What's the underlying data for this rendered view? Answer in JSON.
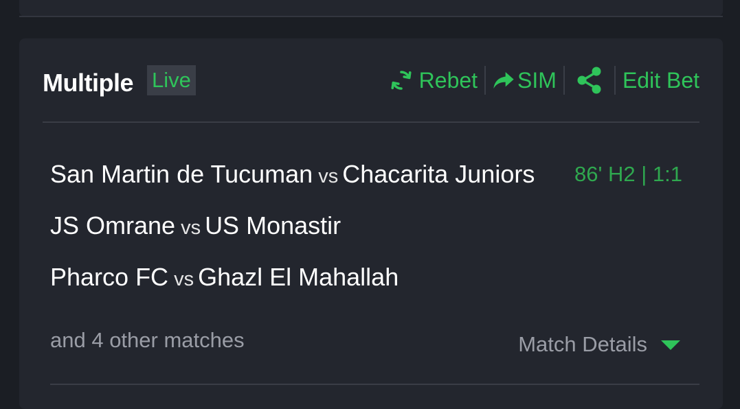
{
  "bet": {
    "title": "Multiple",
    "badge": "Live",
    "actions": {
      "rebet": "Rebet",
      "sim": "SIM",
      "edit": "Edit Bet"
    },
    "vs_label": "vs",
    "matches": [
      {
        "home": "San Martin de Tucuman",
        "away": "Chacarita Juniors",
        "status": "86' H2 | 1:1"
      },
      {
        "home": "JS Omrane",
        "away": "US Monastir"
      },
      {
        "home": "Pharco FC",
        "away": "Ghazl El Mahallah"
      }
    ],
    "others": "and 4 other matches",
    "details_label": "Match Details"
  },
  "colors": {
    "accent": "#2fc45a",
    "background": "#1b1e24",
    "card": "#23262e",
    "muted_text": "#9a9da6"
  },
  "icons": {
    "rebet": "refresh-icon",
    "sim": "share-arrow-icon",
    "share": "share-icon",
    "details": "caret-down-icon"
  }
}
